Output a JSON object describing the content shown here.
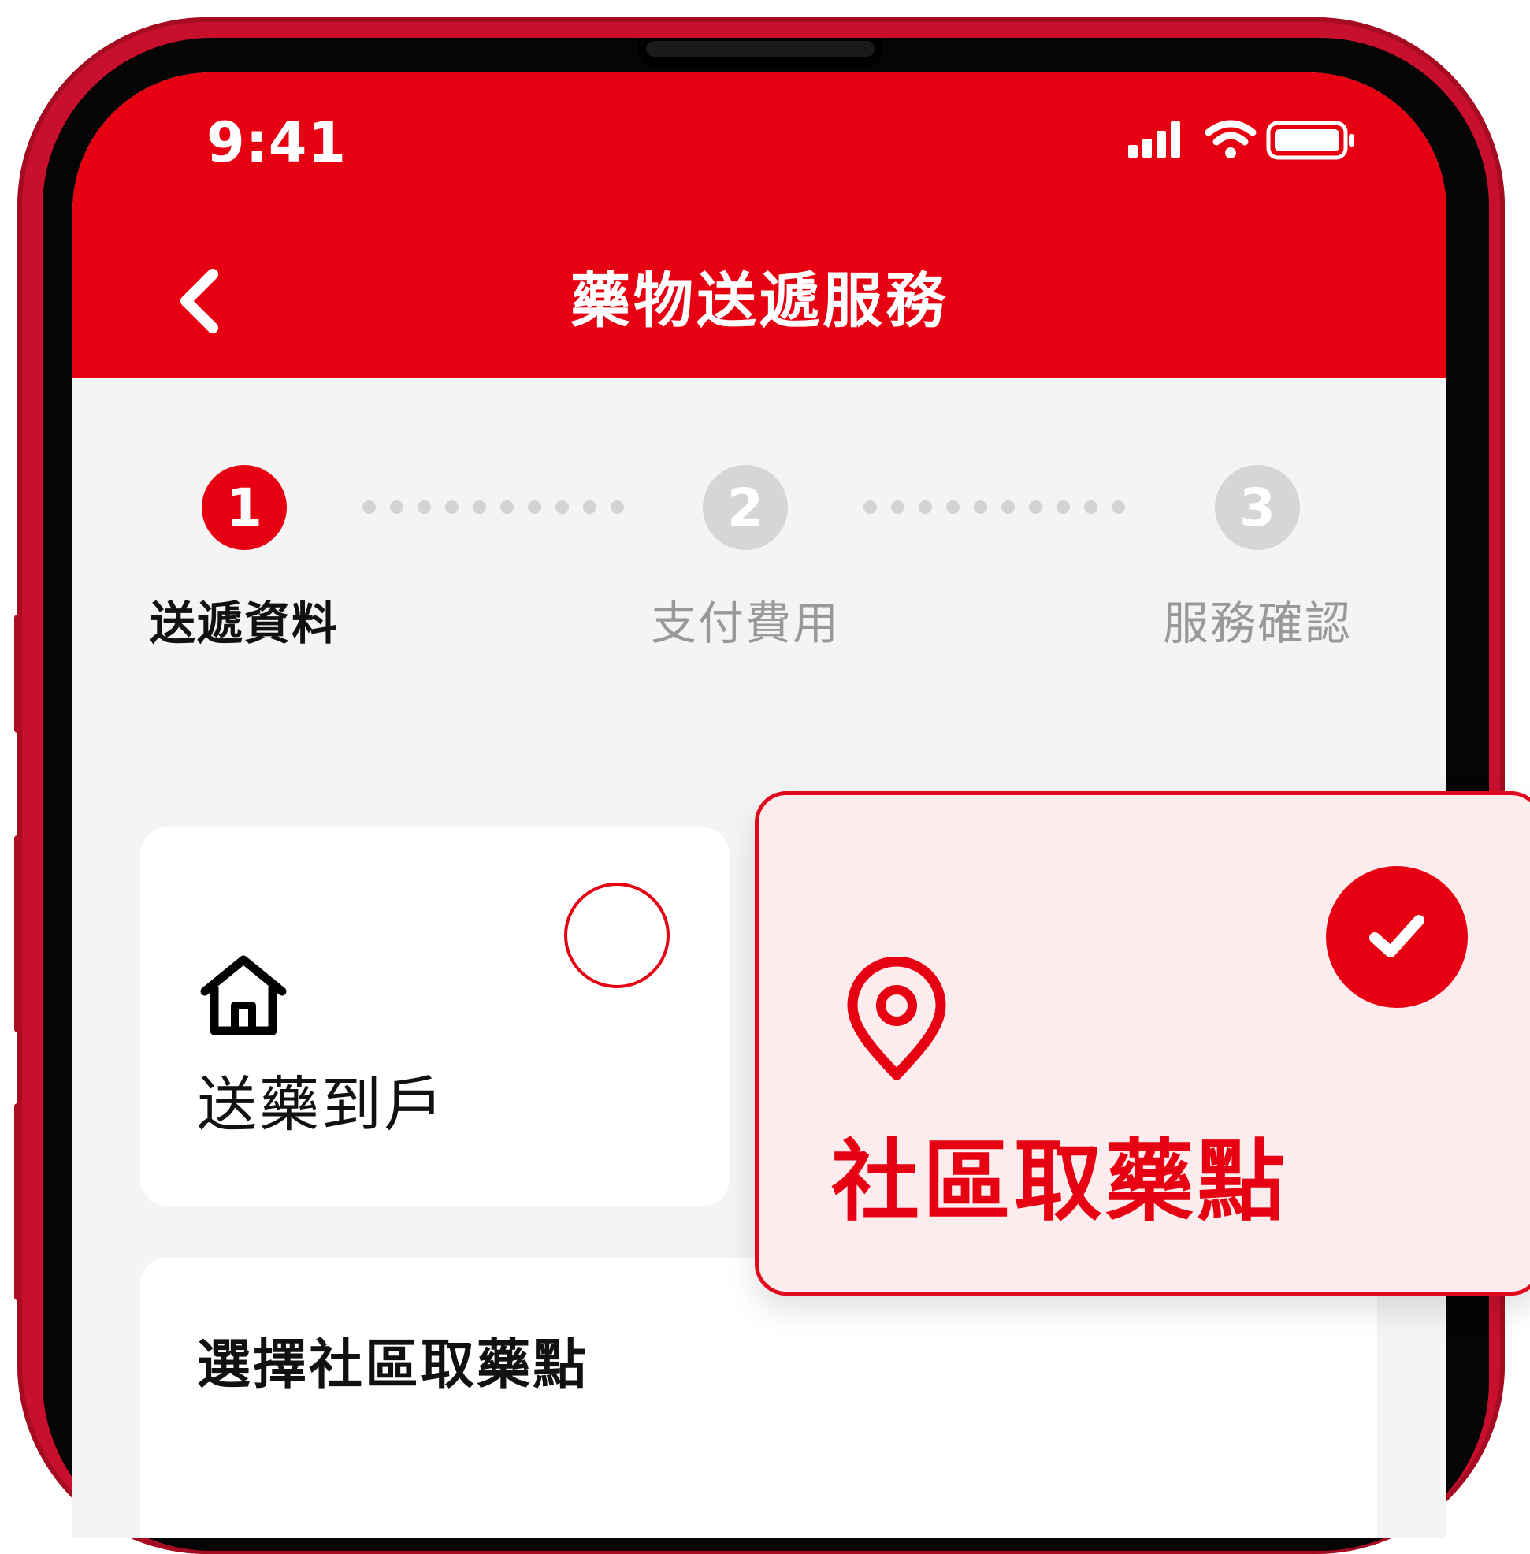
{
  "status_bar": {
    "time": "9:41"
  },
  "header": {
    "title": "藥物送遞服務"
  },
  "stepper": {
    "steps": [
      {
        "number": "1",
        "label": "送遞資料",
        "state": "active"
      },
      {
        "number": "2",
        "label": "支付費用",
        "state": "inactive"
      },
      {
        "number": "3",
        "label": "服務確認",
        "state": "inactive"
      }
    ]
  },
  "options": {
    "home_delivery": {
      "label": "送藥到戶",
      "icon": "home-icon",
      "selected": false
    },
    "community_pickup": {
      "label": "社區取藥點",
      "icon": "location-pin-icon",
      "selected": true
    }
  },
  "pickup_section": {
    "title": "選擇社區取藥點"
  },
  "colors": {
    "brand_red": "#e60012",
    "frame_red": "#c8102e",
    "selected_bg": "#fdecee"
  }
}
